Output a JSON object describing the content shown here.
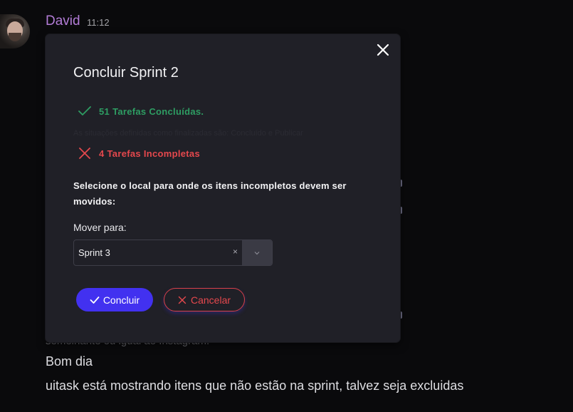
{
  "message": {
    "author": "David",
    "time": "11:12",
    "faded_line": "semelhante ou igual ao Instagram.",
    "lines": [
      "Bom dia",
      "uitask está mostrando itens que não estão na sprint, talvez seja excluidas"
    ]
  },
  "modal": {
    "title": "Concluir Sprint 2",
    "completed": {
      "count": "51",
      "label": "Tarefas Concluídas."
    },
    "hint": "As situações definidas como finalizadas são: Concluído e Publicar",
    "incomplete": {
      "count": "4",
      "label": "Tarefas Incompletas"
    },
    "instruction": "Selecione o local para onde os itens incompletos devem ser movidos:",
    "move_label": "Mover para:",
    "select": {
      "value": "Sprint 3",
      "clear_glyph": "×"
    },
    "buttons": {
      "confirm": "Concluir",
      "cancel": "Cancelar"
    }
  },
  "colors": {
    "primary": "#4231f0",
    "success": "#2e9d63",
    "danger": "#e5484d",
    "author": "#b27cd6",
    "modal_bg": "#202027"
  }
}
